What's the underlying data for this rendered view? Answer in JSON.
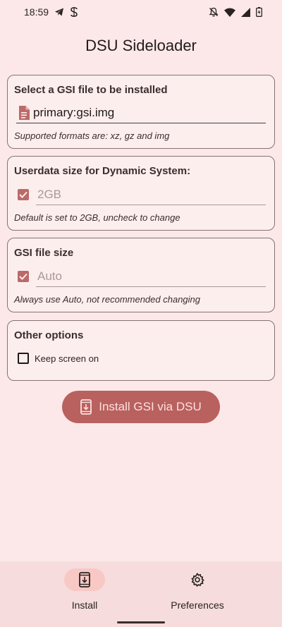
{
  "status_bar": {
    "time": "18:59",
    "icons_left": [
      "telegram-icon",
      "sync-app-icon"
    ],
    "icons_right": [
      "notifications-off-icon",
      "wifi-icon",
      "cell-signal-icon",
      "battery-icon"
    ]
  },
  "app": {
    "title": "DSU Sideloader"
  },
  "gsi_card": {
    "title": "Select a GSI file to be installed",
    "file_value": "primary:gsi.img",
    "helper": "Supported formats are: xz, gz and img"
  },
  "userdata_card": {
    "title": "Userdata size for Dynamic System:",
    "checked": true,
    "value": "2GB",
    "helper": "Default is set to 2GB, uncheck to change"
  },
  "gsi_size_card": {
    "title": "GSI file size",
    "checked": true,
    "value": "Auto",
    "helper": "Always use Auto, not recommended changing"
  },
  "other_card": {
    "title": "Other options",
    "keep_screen_on_label": "Keep screen on",
    "keep_screen_on_checked": false
  },
  "install_button": {
    "label": "Install GSI via DSU"
  },
  "bottom_nav": {
    "items": [
      {
        "label": "Install",
        "icon": "install-phone-icon",
        "active": true
      },
      {
        "label": "Preferences",
        "icon": "gear-icon",
        "active": false
      }
    ]
  },
  "colors": {
    "background": "#fce8e8",
    "accent": "#b9615e",
    "outline": "#857373",
    "nav_background": "#f6dcdc",
    "nav_active_pill": "#f8c8c4"
  }
}
